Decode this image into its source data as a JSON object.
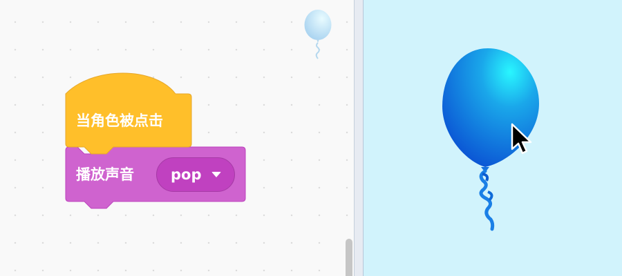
{
  "code_area": {
    "hat_block": {
      "label": "当角色被点击",
      "color": "#ffbf2a"
    },
    "sound_block": {
      "label": "播放声音",
      "sound_value": "pop",
      "color": "#cf63cf"
    },
    "sprite_thumbnail_icon": "balloon-icon"
  },
  "stage": {
    "background_color": "#d1f3fc",
    "sprite_icon": "balloon-icon",
    "cursor_icon": "mouse-pointer-icon"
  }
}
